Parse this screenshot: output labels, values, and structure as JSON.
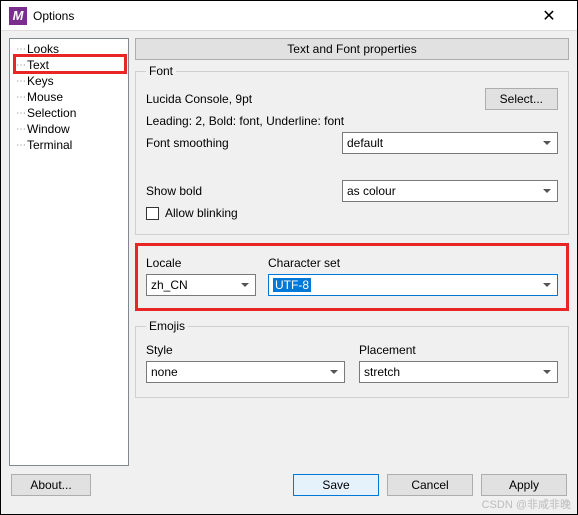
{
  "title": "Options",
  "tree": [
    "Looks",
    "Text",
    "Keys",
    "Mouse",
    "Selection",
    "Window",
    "Terminal"
  ],
  "props_button": "Text and Font properties",
  "font": {
    "legend": "Font",
    "desc": "Lucida Console, 9pt",
    "select_btn": "Select...",
    "leading": "Leading: 2, Bold: font, Underline: font",
    "smoothing_label": "Font smoothing",
    "smoothing_value": "default",
    "showbold_label": "Show bold",
    "showbold_value": "as colour",
    "blinking_label": "Allow blinking"
  },
  "locale": {
    "locale_label": "Locale",
    "locale_value": "zh_CN",
    "charset_label": "Character set",
    "charset_value": "UTF-8"
  },
  "emojis": {
    "legend": "Emojis",
    "style_label": "Style",
    "style_value": "none",
    "placement_label": "Placement",
    "placement_value": "stretch"
  },
  "footer": {
    "about": "About...",
    "save": "Save",
    "cancel": "Cancel",
    "apply": "Apply"
  },
  "watermark": "CSDN @非咸非晚"
}
